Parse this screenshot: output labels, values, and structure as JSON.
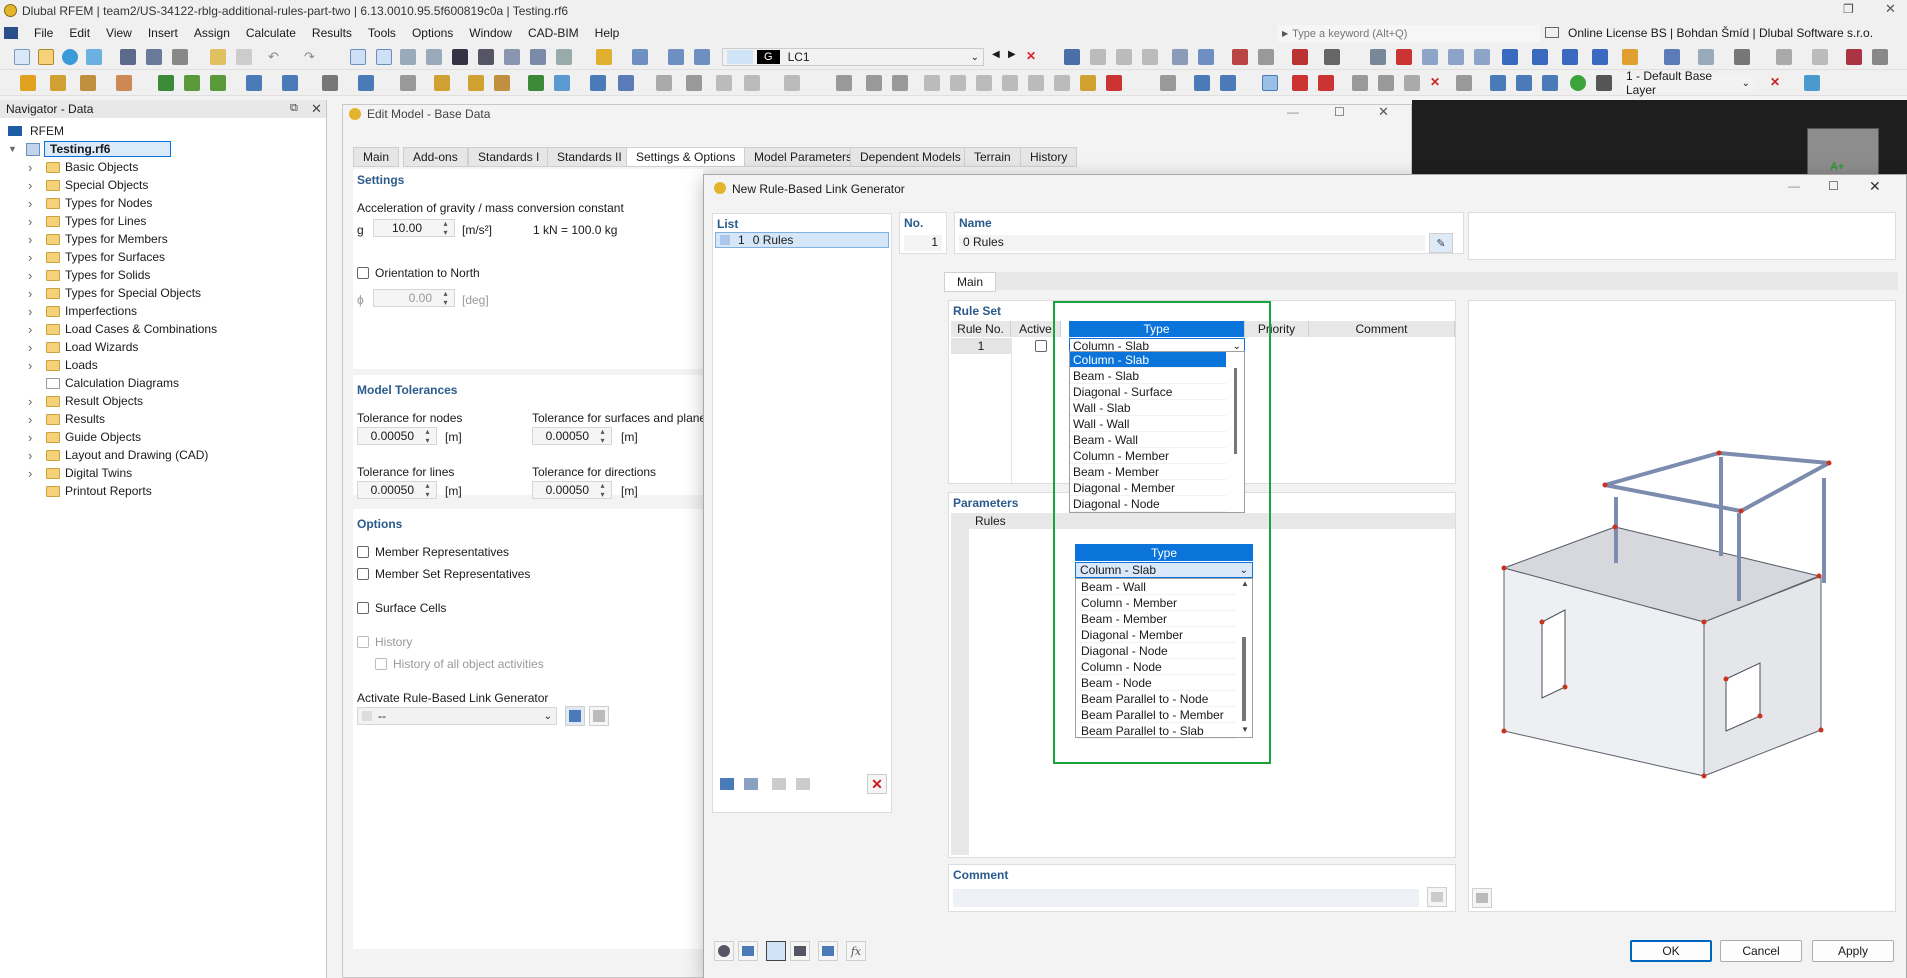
{
  "app": {
    "title": "Dlubal RFEM | team2/US-34122-rblg-additional-rules-part-two | 6.13.0010.95.5f600819c0a | Testing.rf6",
    "search_placeholder": "Type a keyword (Alt+Q)",
    "license": "Online License BS | Bohdan Šmíd | Dlubal Software s.r.o.",
    "menu": [
      "File",
      "Edit",
      "View",
      "Insert",
      "Assign",
      "Calculate",
      "Results",
      "Tools",
      "Options",
      "Window",
      "CAD-BIM",
      "Help"
    ],
    "loadcase_code": "G",
    "loadcase": "LC1",
    "layer": "1 - Default Base Layer"
  },
  "navigator": {
    "title": "Navigator - Data",
    "root": "RFEM",
    "file": "Testing.rf6",
    "items": [
      "Basic Objects",
      "Special Objects",
      "Types for Nodes",
      "Types for Lines",
      "Types for Members",
      "Types for Surfaces",
      "Types for Solids",
      "Types for Special Objects",
      "Imperfections",
      "Load Cases & Combinations",
      "Load Wizards",
      "Loads",
      "Calculation Diagrams",
      "Result Objects",
      "Results",
      "Guide Objects",
      "Layout and Drawing (CAD)",
      "Digital Twins",
      "Printout Reports"
    ]
  },
  "edit_model": {
    "title": "Edit Model - Base Data",
    "tabs": [
      "Main",
      "Add-ons",
      "Standards I",
      "Standards II",
      "Settings & Options",
      "Model Parameters",
      "Dependent Models",
      "Terrain",
      "History"
    ],
    "settings_title": "Settings",
    "gravity_label": "Acceleration of gravity / mass conversion constant",
    "g_symbol": "g",
    "g_value": "10.00",
    "g_unit": "[m/s²]",
    "g_note": "1 kN = 100.0 kg",
    "orientation_label": "Orientation to North",
    "phi_symbol": "ϕ",
    "phi_value": "0.00",
    "phi_unit": "[deg]",
    "tolerances_title": "Model Tolerances",
    "tol_nodes_label": "Tolerance for nodes",
    "tol_nodes": "0.00050",
    "tol_surfaces_label": "Tolerance for surfaces and plane",
    "tol_surfaces": "0.00050",
    "tol_lines_label": "Tolerance for lines",
    "tol_lines": "0.00050",
    "tol_dirs_label": "Tolerance for directions",
    "tol_dirs": "0.00050",
    "unit_m": "[m]",
    "options_title": "Options",
    "opt_member_rep": "Member Representatives",
    "opt_member_set_rep": "Member Set Representatives",
    "opt_surface_cells": "Surface Cells",
    "opt_history": "History",
    "opt_history_all": "History of all object activities",
    "rblg_label": "Activate Rule-Based Link Generator",
    "rblg_value": "--"
  },
  "dialog": {
    "title": "New Rule-Based Link Generator",
    "list_title": "List",
    "list_item_no": "1",
    "list_item_name": "0 Rules",
    "no_label": "No.",
    "no_value": "1",
    "name_label": "Name",
    "name_value": "0 Rules",
    "main_tab": "Main",
    "ruleset_title": "Rule Set",
    "col_rule_no": "Rule No.",
    "col_active": "Active",
    "col_type": "Type",
    "col_priority": "Priority",
    "col_comment": "Comment",
    "row_no": "1",
    "row_type": "Column - Slab",
    "dropdown1": [
      "Column - Slab",
      "Beam - Slab",
      "Diagonal - Surface",
      "Wall - Slab",
      "Wall - Wall",
      "Beam - Wall",
      "Column - Member",
      "Beam - Member",
      "Diagonal - Member",
      "Diagonal - Node"
    ],
    "parameters_title": "Parameters",
    "rules_label": "Rules",
    "type2_header": "Type",
    "type2_value": "Column - Slab",
    "dropdown2": [
      "Beam - Wall",
      "Column - Member",
      "Beam - Member",
      "Diagonal - Member",
      "Diagonal - Node",
      "Column - Node",
      "Beam - Node",
      "Beam Parallel to - Node",
      "Beam Parallel to - Member",
      "Beam Parallel to - Slab"
    ],
    "comment_title": "Comment",
    "ok": "OK",
    "cancel": "Cancel",
    "apply": "Apply"
  },
  "colors": {
    "accent": "#0a74da",
    "highlight_box": "#1aa33a",
    "section_title": "#2a5b8a",
    "model_line": "#7b8cae",
    "node": "#c8321e"
  }
}
